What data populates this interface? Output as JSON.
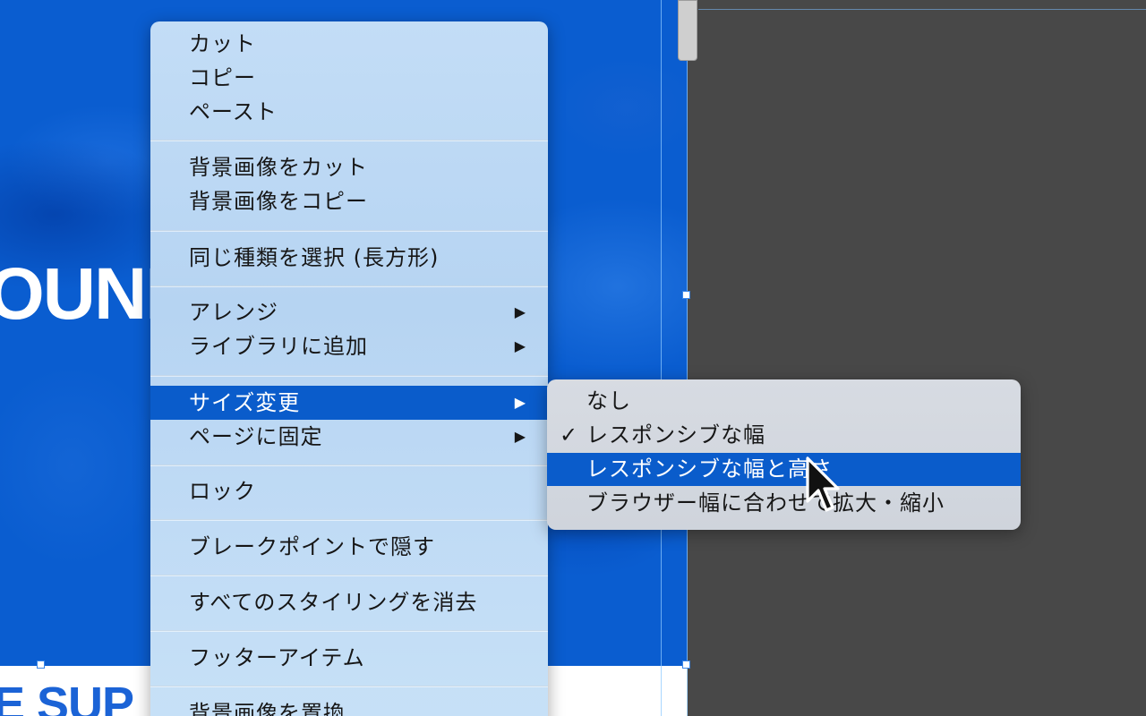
{
  "canvas": {
    "hero_text": "OUNE",
    "footer_text": "E SUP"
  },
  "context_menu": {
    "items": [
      {
        "label": "カット"
      },
      {
        "label": "コピー"
      },
      {
        "label": "ペースト"
      },
      {
        "label": "背景画像をカット"
      },
      {
        "label": "背景画像をコピー"
      },
      {
        "label": "同じ種類を選択 (長方形)"
      },
      {
        "label": "アレンジ",
        "submenu": true
      },
      {
        "label": "ライブラリに追加",
        "submenu": true
      },
      {
        "label": "サイズ変更",
        "submenu": true,
        "highlighted": true
      },
      {
        "label": "ページに固定",
        "submenu": true
      },
      {
        "label": "ロック"
      },
      {
        "label": "ブレークポイントで隠す"
      },
      {
        "label": "すべてのスタイリングを消去"
      },
      {
        "label": "フッターアイテム"
      },
      {
        "label": "背景画像を置換"
      }
    ],
    "submenu_arrow": "▶"
  },
  "resize_submenu": {
    "items": [
      {
        "label": "なし"
      },
      {
        "label": "レスポンシブな幅",
        "checked": true
      },
      {
        "label": "レスポンシブな幅と高さ",
        "highlighted": true
      },
      {
        "label": "ブラウザー幅に合わせて拡大・縮小"
      }
    ],
    "check_mark": "✓"
  },
  "colors": {
    "highlight": "#0a5ccb",
    "artboard": "#0a5dd0",
    "workspace": "#484848"
  }
}
